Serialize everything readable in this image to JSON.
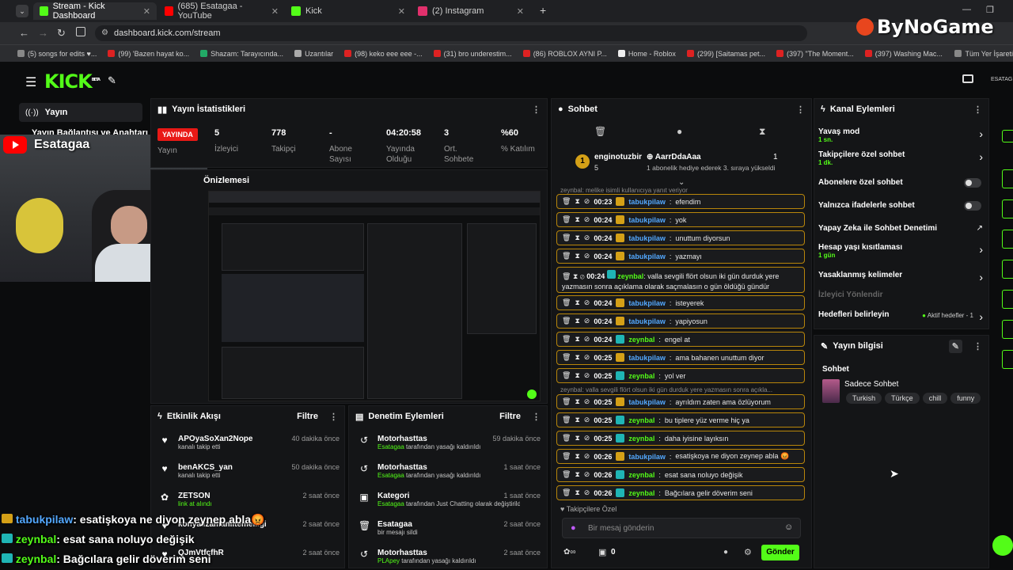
{
  "browser": {
    "tabs": [
      {
        "title": "Stream - Kick Dashboard",
        "color": "#53fc18"
      },
      {
        "title": "(685) Esatagaa - YouTube",
        "color": "#ff0000"
      },
      {
        "title": "Kick",
        "color": "#53fc18"
      },
      {
        "title": "(2) Instagram",
        "color": "#e1306c"
      }
    ],
    "url": "dashboard.kick.com/stream",
    "bookmarks": [
      "(5) songs for edits ♥...",
      "(99) 'Bazen hayat ko...",
      "Shazam: Tarayıcında...",
      "Uzantılar",
      "(98) keko eee eee -...",
      "(31) bro underestim...",
      "(86) ROBLOX AYNI P...",
      "Home - Roblox",
      "(299) [Saitamas pet...",
      "(397) \"The Moment...",
      "(397) Washing Mac..."
    ],
    "all_bookmarks": "Tüm Yer İşareti"
  },
  "watermark": "ByNoGame",
  "kick": {
    "logo": "KICK",
    "beta": "BETA",
    "user_short": "ESATAG"
  },
  "sidebar": {
    "item1": "Yayın",
    "item2": "Yayın Bağlantısı ve Anahtarı"
  },
  "youtube_overlay": {
    "name": "Esatagaa"
  },
  "stats": {
    "title": "Yayın İstatistikleri",
    "live": "YAYINDA",
    "live_label": "Yayın",
    "items": [
      {
        "value": "5",
        "label": "İzleyici"
      },
      {
        "value": "778",
        "label": "Takipçi"
      },
      {
        "value": "-",
        "label": "Abone Sayısı"
      },
      {
        "value": "04:20:58",
        "label": "Yayında Olduğu"
      },
      {
        "value": "3",
        "label": "Ort. Sohbete"
      },
      {
        "value": "%60",
        "label": "% Katılım"
      }
    ]
  },
  "preview": {
    "title": "Önizlemesi"
  },
  "activity": {
    "title": "Etkinlik Akışı",
    "filter": "Filtre",
    "items": [
      {
        "name": "APOyaSoXan2Nope",
        "sub": "kanalı takip etti",
        "time": "40 dakika önce"
      },
      {
        "name": "benAKCS_yan",
        "sub": "kanalı takip etti",
        "time": "50 dakika önce"
      },
      {
        "name": "ZETSON",
        "sub": "link at alındı",
        "time": "2 saat önce"
      },
      {
        "name": "konyalizamanlitemelligi",
        "sub": "",
        "time": "2 saat önce"
      },
      {
        "name": "QJmVtfcfhR",
        "sub": "",
        "time": "2 saat önce"
      }
    ]
  },
  "moderation": {
    "title": "Denetim Eylemleri",
    "filter": "Filtre",
    "items": [
      {
        "name": "Motorhasttas",
        "sub_user": "Esatagaa",
        "sub": "tarafından yasağı kaldırıldı",
        "time": "59 dakika önce"
      },
      {
        "name": "Motorhasttas",
        "sub_user": "Esatagaa",
        "sub": "tarafından yasağı kaldırıldı",
        "time": "1 saat önce"
      },
      {
        "name": "Kategori",
        "sub_user": "Esatagaa",
        "sub": "tarafından Just Chatting olarak değiştirildi",
        "time": "1 saat önce"
      },
      {
        "name": "Esatagaa",
        "sub_user": "",
        "sub": "bir mesajı sildi",
        "time": "2 saat önce"
      },
      {
        "name": "Motorhasttas",
        "sub_user": "PLApey",
        "sub": "tarafından yasağı kaldırıldı",
        "time": "2 saat önce"
      }
    ]
  },
  "chat": {
    "title": "Sohbet",
    "top1": {
      "name": "enginotuzbir",
      "count": "5"
    },
    "top2": {
      "name": "AarrDdaAaa",
      "count": "1"
    },
    "gift_note": "1 abonelik hediye ederek 3. sıraya yükseldi",
    "reply1": "zeynbal: melike isimli kullanıcıya yanıt veriyor",
    "reply2": "zeynbal: valla sevgili flört olsun iki gün durduk yere yazmasın sonra açıkla...",
    "messages": [
      {
        "time": "00:23",
        "user": "tabukpilaw",
        "color": "blue",
        "text": "efendim"
      },
      {
        "time": "00:24",
        "user": "tabukpilaw",
        "color": "blue",
        "text": "yok"
      },
      {
        "time": "00:24",
        "user": "tabukpilaw",
        "color": "blue",
        "text": "unuttum diyorsun"
      },
      {
        "time": "00:24",
        "user": "tabukpilaw",
        "color": "blue",
        "text": "yazmayı"
      },
      {
        "time": "00:24",
        "user": "zeynbal",
        "color": "green",
        "text": "valla sevgili flört olsun iki gün durduk yere yazmasın sonra açıklama olarak saçmalasın o gün öldüğü gündür"
      },
      {
        "time": "00:24",
        "user": "tabukpilaw",
        "color": "blue",
        "text": "isteyerek"
      },
      {
        "time": "00:24",
        "user": "tabukpilaw",
        "color": "blue",
        "text": "yapiyosun"
      },
      {
        "time": "00:24",
        "user": "zeynbal",
        "color": "green",
        "text": "engel at"
      },
      {
        "time": "00:25",
        "user": "tabukpilaw",
        "color": "blue",
        "text": "ama bahanen unuttum diyor"
      },
      {
        "time": "00:25",
        "user": "zeynbal",
        "color": "green",
        "text": "yol ver"
      },
      {
        "time": "00:25",
        "user": "tabukpilaw",
        "color": "blue",
        "text": "ayrıldım zaten ama özlüyorum"
      },
      {
        "time": "00:25",
        "user": "zeynbal",
        "color": "green",
        "text": "bu tiplere yüz verme hiç ya"
      },
      {
        "time": "00:25",
        "user": "zeynbal",
        "color": "green",
        "text": "daha iyisine layıksın"
      },
      {
        "time": "00:26",
        "user": "tabukpilaw",
        "color": "blue",
        "text": "esatişkoya ne diyon zeynep abla 😡"
      },
      {
        "time": "00:26",
        "user": "zeynbal",
        "color": "green",
        "text": "esat sana noluyo değişik"
      },
      {
        "time": "00:26",
        "user": "zeynbal",
        "color": "green",
        "text": "Bağcılara gelir döverim seni"
      }
    ],
    "followers_only": "Takipçilere Özel",
    "placeholder": "Bir mesaj gönderin",
    "count": "0",
    "send": "Gönder"
  },
  "channel": {
    "title": "Kanal Eylemleri",
    "options": [
      {
        "label": "Yavaş mod",
        "sub": "1 sn."
      },
      {
        "label": "Takipçilere özel sohbet",
        "sub": "1 dk."
      },
      {
        "label": "Abonelere özel sohbet",
        "sub": ""
      },
      {
        "label": "Yalnızca ifadelerle sohbet",
        "sub": ""
      },
      {
        "label": "Yapay Zeka ile Sohbet Denetimi",
        "sub": ""
      },
      {
        "label": "Hesap yaşı kısıtlaması",
        "sub": "1 gün"
      },
      {
        "label": "Yasaklanmış kelimeler",
        "sub": ""
      },
      {
        "label": "İzleyici Yönlendir",
        "sub": ""
      },
      {
        "label": "Hedefleri belirleyin",
        "sub": ""
      }
    ],
    "goals_active": "Aktif hedefler - 1"
  },
  "streaminfo": {
    "title": "Yayın bilgisi",
    "category_label": "Sohbet",
    "stream_title": "Sadece Sohbet",
    "tags": [
      "Turkish",
      "Türkçe",
      "chill",
      "funny"
    ]
  },
  "overlay_chat": [
    {
      "user": "tabukpilaw",
      "text": ": esatişkoya ne diyon zeynep abla😡",
      "color": "#53a8ff"
    },
    {
      "user": "zeynbal",
      "text": ": esat sana noluyo değişik",
      "color": "#53fc18"
    },
    {
      "user": "zeynbal",
      "text": ": Bağcılara gelir döverim seni",
      "color": "#53fc18"
    }
  ]
}
